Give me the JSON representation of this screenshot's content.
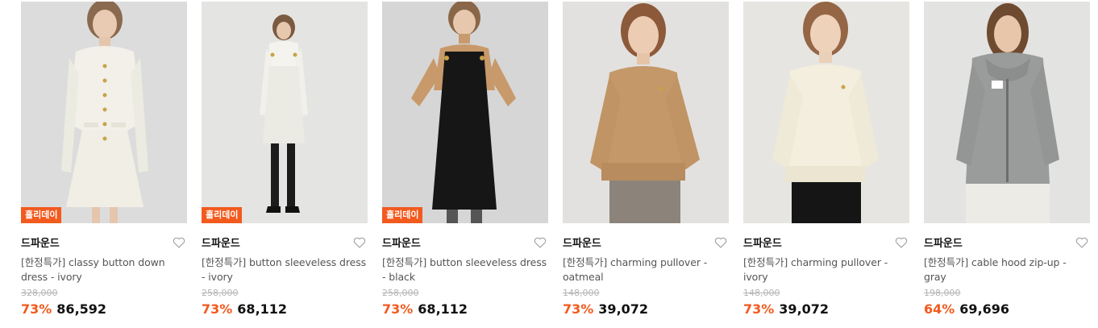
{
  "colors": {
    "accent": "#f25a1e",
    "brand_text": "#111111",
    "name_text": "#555555",
    "original_price": "#b4b4b4"
  },
  "products": [
    {
      "brand": "드파운드",
      "badge": "홀리데이",
      "name": "[한정특가] classy button down dress - ivory",
      "original_price": "328,000",
      "discount": "73%",
      "price": "86,592",
      "wish_icon": "heart-outline-icon",
      "photo": "model-ivory-button-dress"
    },
    {
      "brand": "드파운드",
      "badge": "홀리데이",
      "name": "[한정특가] button sleeveless dress - ivory",
      "original_price": "258,000",
      "discount": "73%",
      "price": "68,112",
      "wish_icon": "heart-outline-icon",
      "photo": "model-ivory-sleeveless-dress"
    },
    {
      "brand": "드파운드",
      "badge": "홀리데이",
      "name": "[한정특가] button sleeveless dress - black",
      "original_price": "258,000",
      "discount": "73%",
      "price": "68,112",
      "wish_icon": "heart-outline-icon",
      "photo": "model-black-sleeveless-dress"
    },
    {
      "brand": "드파운드",
      "badge": "",
      "name": "[한정특가] charming pullover - oatmeal",
      "original_price": "148,000",
      "discount": "73%",
      "price": "39,072",
      "wish_icon": "heart-outline-icon",
      "photo": "model-oatmeal-pullover"
    },
    {
      "brand": "드파운드",
      "badge": "",
      "name": "[한정특가] charming pullover - ivory",
      "original_price": "148,000",
      "discount": "73%",
      "price": "39,072",
      "wish_icon": "heart-outline-icon",
      "photo": "model-ivory-pullover"
    },
    {
      "brand": "드파운드",
      "badge": "",
      "name": "[한정특가] cable hood zip-up - gray",
      "original_price": "198,000",
      "discount": "64%",
      "price": "69,696",
      "wish_icon": "heart-outline-icon",
      "photo": "model-gray-cable-hood-zipup"
    }
  ]
}
